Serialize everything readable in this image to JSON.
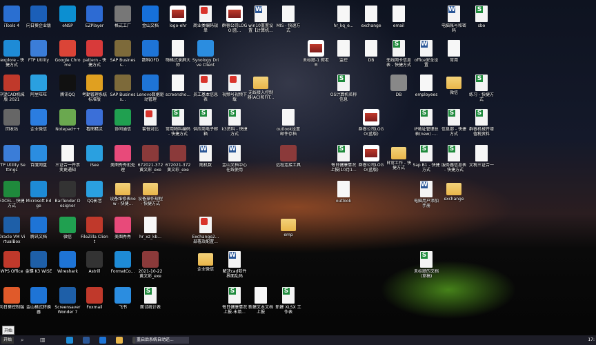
{
  "desktop_icons": [
    {
      "label": "iTools 4",
      "kind": "app",
      "color": "#2a6fd1"
    },
    {
      "label": "向日葵企业版",
      "kind": "app",
      "color": "#1b5fb8"
    },
    {
      "label": "eNSP",
      "kind": "app",
      "color": "#0c8fd1"
    },
    {
      "label": "EZPlayer",
      "kind": "app",
      "color": "#2d6bd3"
    },
    {
      "label": "格式工厂",
      "kind": "app",
      "color": "#777777"
    },
    {
      "label": "金山文档",
      "kind": "app",
      "color": "#1670d9"
    },
    {
      "label": "logo-ehr",
      "kind": "img",
      "color": "#c0392b"
    },
    {
      "label": "商业类编码规单",
      "kind": "pdf",
      "color": "#d9342b"
    },
    {
      "label": "群睿公司LOGO(蓝...",
      "kind": "img",
      "color": "#c0392b"
    },
    {
      "label": "win10重置设置【计算机...",
      "kind": "word",
      "color": "#2b5797"
    },
    {
      "label": "MIS - 快速方式",
      "kind": "doc",
      "color": "#ffffff"
    },
    {
      "label": "hr_kq_e...",
      "kind": "doc",
      "color": "#ffffff"
    },
    {
      "label": "exchange",
      "kind": "doc",
      "color": "#ffffff"
    },
    {
      "label": "email",
      "kind": "doc",
      "color": "#ffffff"
    },
    {
      "label": "电脑账号和密码",
      "kind": "word",
      "color": "#2b5797"
    },
    {
      "label": "sbo",
      "kind": "xls",
      "color": "#1f8a3c"
    },
    {
      "label": "iexplore - 快捷方式",
      "kind": "app",
      "color": "#1e8bd6"
    },
    {
      "label": "FTP Utility",
      "kind": "app",
      "color": "#3b7dd8"
    },
    {
      "label": "Google Chrome",
      "kind": "app",
      "color": "#db4437"
    },
    {
      "label": "pattern - 快捷方式",
      "kind": "app",
      "color": "#d83a3a"
    },
    {
      "label": "SAP Business...",
      "kind": "app",
      "color": "#7d6a3a"
    },
    {
      "label": "数科OFD",
      "kind": "app",
      "color": "#1e74d6"
    },
    {
      "label": "嗨格式录屏大师",
      "kind": "doc",
      "color": "#ffffff"
    },
    {
      "label": "Synology Drive Client",
      "kind": "app",
      "color": "#2b8de0"
    },
    {
      "label": "未标题-1 假老王",
      "kind": "img",
      "color": "#dddddd"
    },
    {
      "label": "监控",
      "kind": "doc",
      "color": "#ffffff"
    },
    {
      "label": "DB",
      "kind": "doc",
      "color": "#ffffff"
    },
    {
      "label": "无线网卡信息表 - 快捷方式",
      "kind": "xls",
      "color": "#1f8a3c"
    },
    {
      "label": "office安全设置",
      "kind": "word",
      "color": "#2b5797"
    },
    {
      "label": "常用",
      "kind": "doc",
      "color": "#ffffff"
    },
    {
      "label": "中望CAD机械版 2021",
      "kind": "app",
      "color": "#c0392b"
    },
    {
      "label": "阿里旺旺",
      "kind": "app",
      "color": "#2aa0e0"
    },
    {
      "label": "腾讯QQ",
      "kind": "app",
      "color": "#111111"
    },
    {
      "label": "考勤管理系统标准版",
      "kind": "app",
      "color": "#e0a020"
    },
    {
      "label": "SAP Business...",
      "kind": "app",
      "color": "#7d6a3a"
    },
    {
      "label": "Lenovo数据驱动管理",
      "kind": "app",
      "color": "#1e74d6"
    },
    {
      "label": "screensho...",
      "kind": "doc",
      "color": "#ffffff"
    },
    {
      "label": "员工基本信息表",
      "kind": "pdf",
      "color": "#d9342b"
    },
    {
      "label": "视频号视频下载",
      "kind": "pdf",
      "color": "#d9342b"
    },
    {
      "label": "无线接入控制器(AC)和FIT...",
      "kind": "folder",
      "color": "#e9b64a"
    },
    {
      "label": "OS计算机名称信息",
      "kind": "xls",
      "color": "#1f8a3c"
    },
    {
      "label": "DB",
      "kind": "app",
      "color": "#888888"
    },
    {
      "label": "employees",
      "kind": "doc",
      "color": "#ffffff"
    },
    {
      "label": "微信",
      "kind": "folder",
      "color": "#e9b64a"
    },
    {
      "label": "练习 - 快捷方式",
      "kind": "xls",
      "color": "#1f8a3c"
    },
    {
      "label": "回收站",
      "kind": "app",
      "color": "#666666"
    },
    {
      "label": "企业微信",
      "kind": "app",
      "color": "#2b7de0"
    },
    {
      "label": "Notepad++",
      "kind": "app",
      "color": "#6aa84f"
    },
    {
      "label": "看图精灵",
      "kind": "app",
      "color": "#3b6fd8"
    },
    {
      "label": "协同通信",
      "kind": "app",
      "color": "#20a050"
    },
    {
      "label": "套餐对比",
      "kind": "pdf",
      "color": "#d9342b"
    },
    {
      "label": "常用物料编码 - 快捷方式",
      "kind": "xls",
      "color": "#1f8a3c"
    },
    {
      "label": "供应商电子邮箱",
      "kind": "xls",
      "color": "#1f8a3c"
    },
    {
      "label": "k3资料 - 快捷方式",
      "kind": "xls",
      "color": "#1f8a3c"
    },
    {
      "label": "outlook设置邮件存档",
      "kind": "doc",
      "color": "#ffffff"
    },
    {
      "label": "群睿公司LOGO(蓝版)",
      "kind": "img",
      "color": "#c0392b"
    },
    {
      "label": "IP地址管理总表(new) -...",
      "kind": "xls",
      "color": "#1f8a3c"
    },
    {
      "label": "信息部 - 快捷方式",
      "kind": "xls",
      "color": "#1f8a3c"
    },
    {
      "label": "群睿机械开增值税资料",
      "kind": "xls",
      "color": "#1f8a3c"
    },
    {
      "label": "FTP Utility Settings",
      "kind": "app",
      "color": "#3b7dd8"
    },
    {
      "label": "百度网盘",
      "kind": "app",
      "color": "#2b8de0"
    },
    {
      "label": "三证合一开票变更通知",
      "kind": "doc",
      "color": "#ffffff"
    },
    {
      "label": "iSee",
      "kind": "app",
      "color": "#2aa0e0"
    },
    {
      "label": "美图秀秀批处理",
      "kind": "app",
      "color": "#e84a7a"
    },
    {
      "label": "672021-372 黄文彩_exe",
      "kind": "app",
      "color": "#8b3a3a"
    },
    {
      "label": "672021-372 黄文彩_exe",
      "kind": "app",
      "color": "#8b3a3a"
    },
    {
      "label": "随机数",
      "kind": "word",
      "color": "#2b5797"
    },
    {
      "label": "金山文档中心在线使用",
      "kind": "word",
      "color": "#2b5797"
    },
    {
      "label": "远程连接工具",
      "kind": "app",
      "color": "#8b3a3a"
    },
    {
      "label": "每日健康情况上报(10月1...",
      "kind": "xls",
      "color": "#1f8a3c"
    },
    {
      "label": "群睿公司LOGO(蓝版)",
      "kind": "img",
      "color": "#c0392b"
    },
    {
      "label": "日常工作 - 快捷方式",
      "kind": "folder",
      "color": "#e9b64a"
    },
    {
      "label": "Sap B1 - 快捷方式",
      "kind": "xls",
      "color": "#1f8a3c"
    },
    {
      "label": "服务器信息表 - 快捷方式",
      "kind": "xls",
      "color": "#1f8a3c"
    },
    {
      "label": "文税三证合一",
      "kind": "doc",
      "color": "#ffffff"
    },
    {
      "label": "EXCEL - 快捷方式",
      "kind": "app",
      "color": "#1f8a3c"
    },
    {
      "label": "Microsoft Edge",
      "kind": "app",
      "color": "#1e8bd6"
    },
    {
      "label": "BarTender Designer",
      "kind": "app",
      "color": "#333333"
    },
    {
      "label": "QQ影音",
      "kind": "app",
      "color": "#2aa0e0"
    },
    {
      "label": "设备维修表new - 快捷...",
      "kind": "folder",
      "color": "#e9b64a"
    },
    {
      "label": "设备操作规程 - 快捷方式",
      "kind": "folder",
      "color": "#e9b64a"
    },
    {
      "label": "outlook",
      "kind": "doc",
      "color": "#ffffff"
    },
    {
      "label": "电脑用户添加手册",
      "kind": "word",
      "color": "#2b5797"
    },
    {
      "label": "exchange",
      "kind": "folder",
      "color": "#e9b64a"
    },
    {
      "label": "Oracle VM VirtualBox",
      "kind": "app",
      "color": "#1e5fa8"
    },
    {
      "label": "腾讯文档",
      "kind": "app",
      "color": "#1e74d6"
    },
    {
      "label": "微信",
      "kind": "app",
      "color": "#20a050"
    },
    {
      "label": "FileZilla Client",
      "kind": "app",
      "color": "#c0392b"
    },
    {
      "label": "美图秀秀",
      "kind": "app",
      "color": "#e84a7a"
    },
    {
      "label": "hr_xz_kb...",
      "kind": "doc",
      "color": "#ffffff"
    },
    {
      "label": "Exchange2... 部署及配置...",
      "kind": "pdf",
      "color": "#d9342b"
    },
    {
      "label": "emp",
      "kind": "folder",
      "color": "#e9b64a"
    },
    {
      "label": "WPS Office",
      "kind": "app",
      "color": "#c0392b"
    },
    {
      "label": "金蝶 K3 WISE",
      "kind": "app",
      "color": "#1e5fa8"
    },
    {
      "label": "Wireshark",
      "kind": "app",
      "color": "#1e74d6"
    },
    {
      "label": "Astrill",
      "kind": "app",
      "color": "#333333"
    },
    {
      "label": "FormatCo...",
      "kind": "app",
      "color": "#1e8bd6"
    },
    {
      "label": "2021-10-22 黄文彩_exe",
      "kind": "app",
      "color": "#8b3a3a"
    },
    {
      "label": "企业微信",
      "kind": "folder",
      "color": "#e9b64a"
    },
    {
      "label": "解决cad软件界面乱码",
      "kind": "word",
      "color": "#2b5797"
    },
    {
      "label": "未标题的文档(草稿)",
      "kind": "xls",
      "color": "#1f8a3c"
    },
    {
      "label": "向日葵控制端",
      "kind": "app",
      "color": "#e05a2a"
    },
    {
      "label": "金山格式转换器",
      "kind": "app",
      "color": "#1e74d6"
    },
    {
      "label": "Screensaver Wonder 7",
      "kind": "app",
      "color": "#1e5fa8"
    },
    {
      "label": "Foxmail",
      "kind": "app",
      "color": "#c0392b"
    },
    {
      "label": "飞书",
      "kind": "app",
      "color": "#2b8de0"
    },
    {
      "label": "面试统计表",
      "kind": "xls",
      "color": "#1f8a3c"
    },
    {
      "label": "每日健康情况上报-未填...",
      "kind": "xls",
      "color": "#1f8a3c"
    },
    {
      "label": "新建文本文档上报",
      "kind": "doc",
      "color": "#ffffff"
    },
    {
      "label": "新建 XLSX 工作表",
      "kind": "xls",
      "color": "#1f8a3c"
    }
  ],
  "taskbar": {
    "start_label": "开始",
    "search_glyph": "⌕",
    "taskview_glyph": "▥",
    "pinned": [
      {
        "name": "edge",
        "color": "#1e8bd6"
      },
      {
        "name": "store",
        "color": "#2b5797"
      },
      {
        "name": "outlook",
        "color": "#1e74d6"
      },
      {
        "name": "explorer",
        "color": "#e9b64a"
      },
      {
        "name": "terminal",
        "color": "#444444"
      }
    ],
    "active_window": "重启后系统自动还...",
    "clock": "17:"
  },
  "tooltip": "开始"
}
